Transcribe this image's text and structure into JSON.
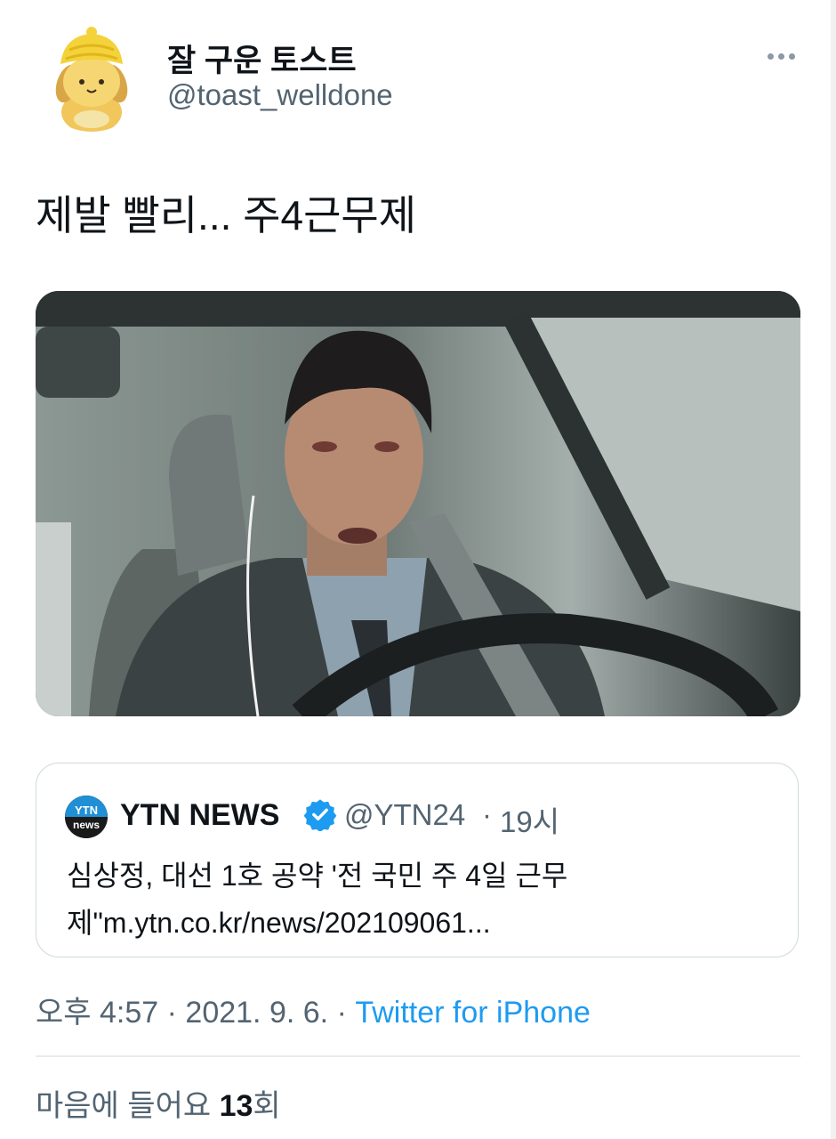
{
  "author": {
    "display_name": "잘 구운 토스트",
    "handle": "@toast_welldone",
    "avatar_icon": "pompompurin-avatar"
  },
  "tweet": {
    "text": "제발 빨리... 주4근무제",
    "media_description_icon": "movie-still-man-in-car"
  },
  "quote": {
    "name": "YTN NEWS",
    "logo_text_top": "YTN",
    "logo_text_bottom": "news",
    "verified_icon": "verified-badge-icon",
    "handle": "@YTN24",
    "separator": "·",
    "time": "19시",
    "text": "심상정, 대선 1호 공약 '전 국민 주 4일 근무제\"m.ytn.co.kr/news/202109061..."
  },
  "meta": {
    "time": "오후 4:57",
    "date": "2021. 9. 6.",
    "separator": "·",
    "source": "Twitter for iPhone"
  },
  "likes": {
    "label": "마음에 들어요",
    "count": "13",
    "unit": "회"
  },
  "colors": {
    "accent": "#1d9bf0",
    "secondary_text": "#536471",
    "primary_text": "#0f1419"
  }
}
